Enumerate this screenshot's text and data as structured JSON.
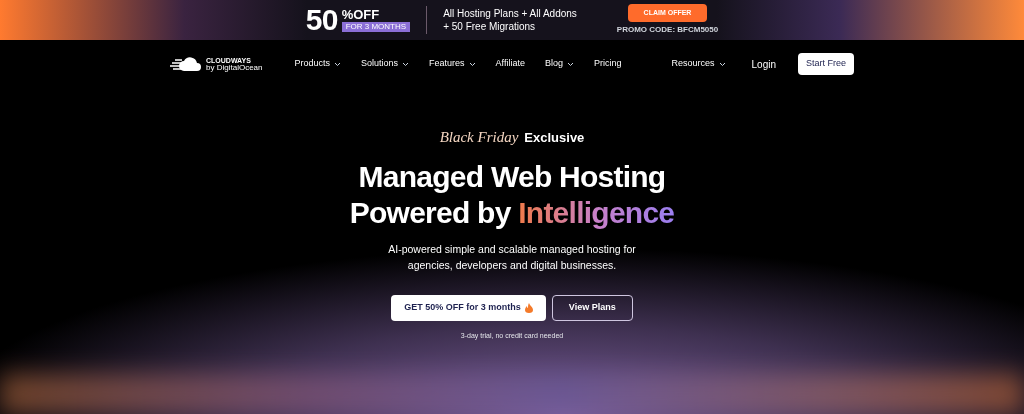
{
  "promo_banner": {
    "discount": "50",
    "discount_suffix": "%OFF",
    "duration": "FOR 3 MONTHS",
    "offer_lines": [
      "All Hosting Plans + All Addons",
      "+ 50 Free Migrations"
    ],
    "button": "CLAIM OFFER",
    "promo_code": "PROMO CODE: BFCM5050"
  },
  "navbar": {
    "logo": {
      "name": "CLOUDWAYS",
      "tagline": "by DigitalOcean"
    },
    "items": [
      {
        "label": "Products",
        "has_menu": true
      },
      {
        "label": "Solutions",
        "has_menu": true
      },
      {
        "label": "Features",
        "has_menu": true
      },
      {
        "label": "Affiliate",
        "has_menu": false
      },
      {
        "label": "Blog",
        "has_menu": true
      },
      {
        "label": "Pricing",
        "has_menu": false
      }
    ],
    "right_items": [
      {
        "label": "Resources",
        "has_menu": true
      }
    ],
    "login": "Login",
    "start_button": "Start Free"
  },
  "hero": {
    "eyebrow_script": "Black Friday",
    "eyebrow": "Exclusive",
    "headline": "Managed Web Hosting",
    "headline_line2": "Powered by",
    "headline_highlight": "Intelligence",
    "subtitle": "AI-powered simple and scalable managed hosting  for agencies, developers and digital businesses.",
    "primary_button": "GET 50% OFF for 3 months",
    "secondary_button": "View Plans",
    "note": "3-day trial, no credit card needed"
  }
}
